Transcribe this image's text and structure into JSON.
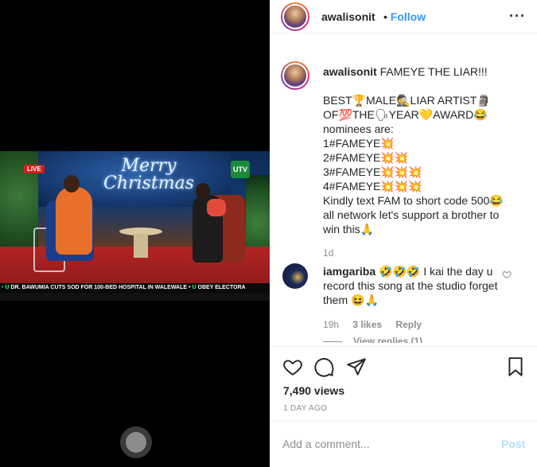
{
  "video": {
    "overlay_title": "Merry Christmas",
    "live_badge": "LIVE",
    "channel_logo": "UTV",
    "ticker_text": "DR. BAWUMIA CUTS SOD FOR 100-BED HOSPITAL IN WALEWALE",
    "ticker_text_2": "OBEY ELECTORA",
    "control_icon": "record-button-icon"
  },
  "header": {
    "username": "awalisonit",
    "separator": "•",
    "follow_label": "Follow",
    "more_icon": "ellipsis-icon"
  },
  "caption": {
    "username": "awalisonit",
    "text": "FAMEYE THE LIAR!!!\n\nBEST🏆MALE🕵️LIAR ARTIST🗿\nOF💯THE🗣YEAR💛AWARD😂\nnominees are:\n1#FAMEYE💥\n2#FAMEYE💥💥\n3#FAMEYE💥💥💥\n4#FAMEYE💥💥💥\nKindly text FAM to short code 500😂\nall network let's support a brother to\nwin this🙏",
    "time": "1d"
  },
  "comment": {
    "username": "iamgariba",
    "text": "🤣🤣🤣 I kai the day u record this song at the studio forget them 😆🙏",
    "time": "19h",
    "likes": "3 likes",
    "reply_label": "Reply",
    "view_replies": "View replies (1)",
    "like_icon": "heart-outline-icon"
  },
  "actions": {
    "like_icon": "heart-icon",
    "comment_icon": "comment-bubble-icon",
    "share_icon": "paper-plane-icon",
    "save_icon": "bookmark-icon",
    "views": "7,490 views",
    "date": "1 DAY AGO"
  },
  "add_comment": {
    "placeholder": "Add a comment...",
    "post_label": "Post"
  },
  "colors": {
    "accent": "#3897f0",
    "post_disabled": "#b2dffc",
    "muted": "#8e8e8e",
    "text": "#262626"
  }
}
